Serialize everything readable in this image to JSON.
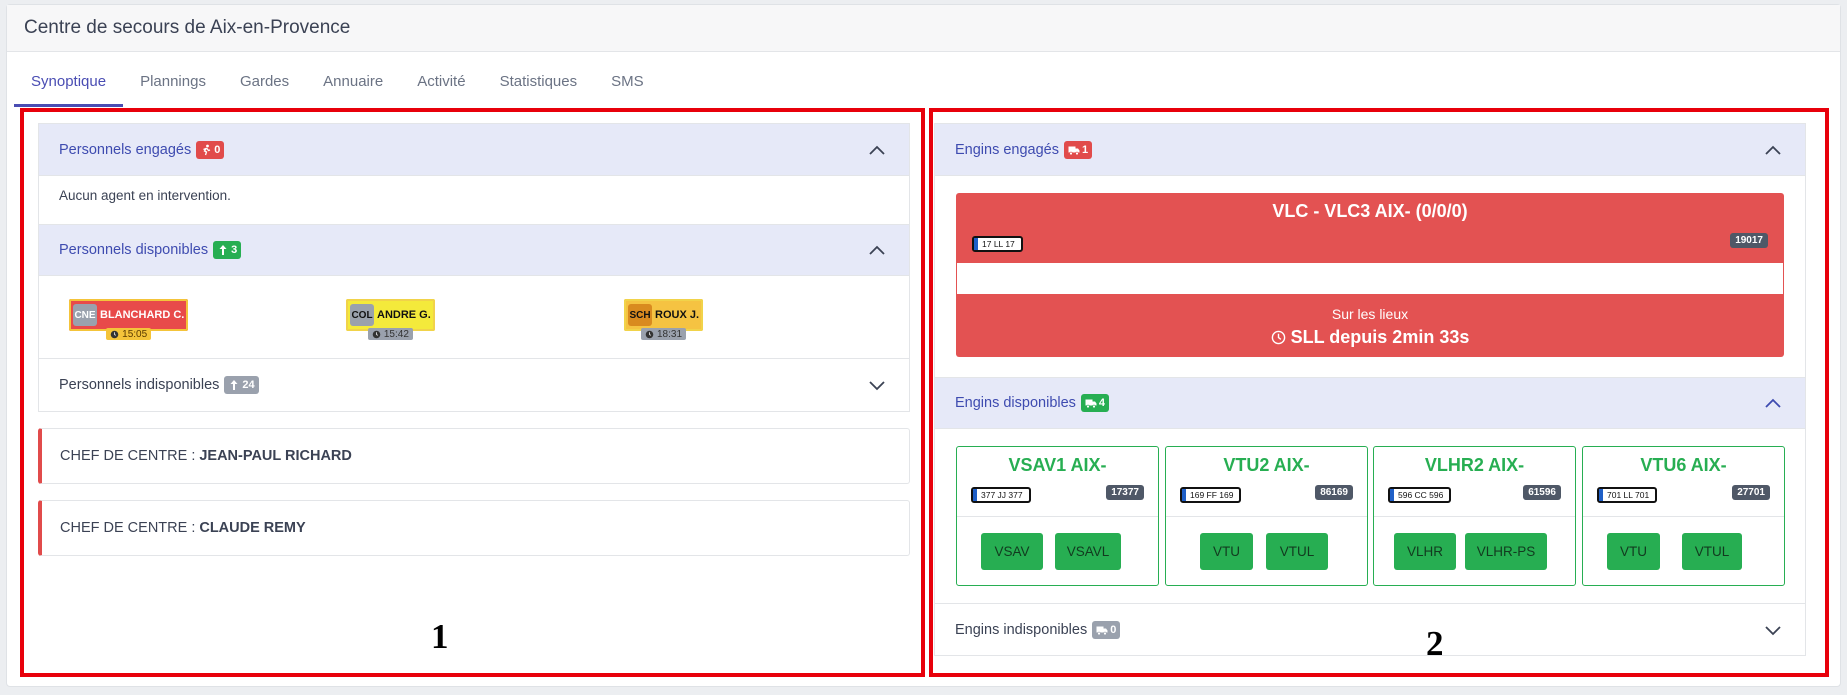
{
  "header": {
    "title": "Centre de secours de Aix-en-Provence"
  },
  "tabs": [
    "Synoptique",
    "Plannings",
    "Gardes",
    "Annuaire",
    "Activité",
    "Statistiques",
    "SMS"
  ],
  "left": {
    "engaged": {
      "label": "Personnels engagés",
      "count": "0",
      "empty_text": "Aucun agent en intervention."
    },
    "available": {
      "label": "Personnels disponibles",
      "count": "3",
      "agents": [
        {
          "grade": "CNE",
          "name": "BLANCHARD C.",
          "time": "15:05",
          "bg": "#e84a4a",
          "fg": "#ffffff",
          "grade_bg": "#9aa1ad"
        },
        {
          "grade": "COL",
          "name": "ANDRE G.",
          "time": "15:42",
          "bg": "#f4ea3b",
          "fg": "#111111",
          "grade_bg": "#9aa1ad"
        },
        {
          "grade": "SCH",
          "name": "ROUX J.",
          "time": "18:31",
          "bg": "#f5c342",
          "fg": "#111111",
          "grade_bg": "#d98a1f"
        }
      ]
    },
    "unavailable": {
      "label": "Personnels indisponibles",
      "count": "24"
    },
    "chefs": [
      {
        "label": "CHEF DE CENTRE :",
        "name": "JEAN-PAUL RICHARD"
      },
      {
        "label": "CHEF DE CENTRE :",
        "name": "CLAUDE REMY"
      }
    ],
    "panel_number": "1"
  },
  "right": {
    "engaged": {
      "label": "Engins engagés",
      "count": "1",
      "engine": {
        "title": "VLC - VLC3 AIX- (0/0/0)",
        "plate": "17 LL 17",
        "number": "19017",
        "status": "Sur les lieux",
        "since": "SLL depuis 2min 33s"
      }
    },
    "available": {
      "label": "Engins disponibles",
      "count": "4",
      "vehicles": [
        {
          "name": "VSAV1 AIX-",
          "plate": "377 JJ 377",
          "number": "17377",
          "buttons": [
            "VSAV",
            "VSAVL"
          ]
        },
        {
          "name": "VTU2 AIX-",
          "plate": "169 FF 169",
          "number": "86169",
          "buttons": [
            "VTU",
            "VTUL"
          ]
        },
        {
          "name": "VLHR2 AIX-",
          "plate": "596 CC 596",
          "number": "61596",
          "buttons": [
            "VLHR",
            "VLHR-PS"
          ]
        },
        {
          "name": "VTU6 AIX-",
          "plate": "701 LL 701",
          "number": "27701",
          "buttons": [
            "VTU",
            "VTUL"
          ]
        }
      ]
    },
    "unavailable": {
      "label": "Engins indisponibles",
      "count": "0"
    },
    "panel_number": "2"
  },
  "colors": {
    "accent": "#4a4db3",
    "danger": "#e35252",
    "success": "#27ae52",
    "highlight_border": "#e8000b"
  }
}
